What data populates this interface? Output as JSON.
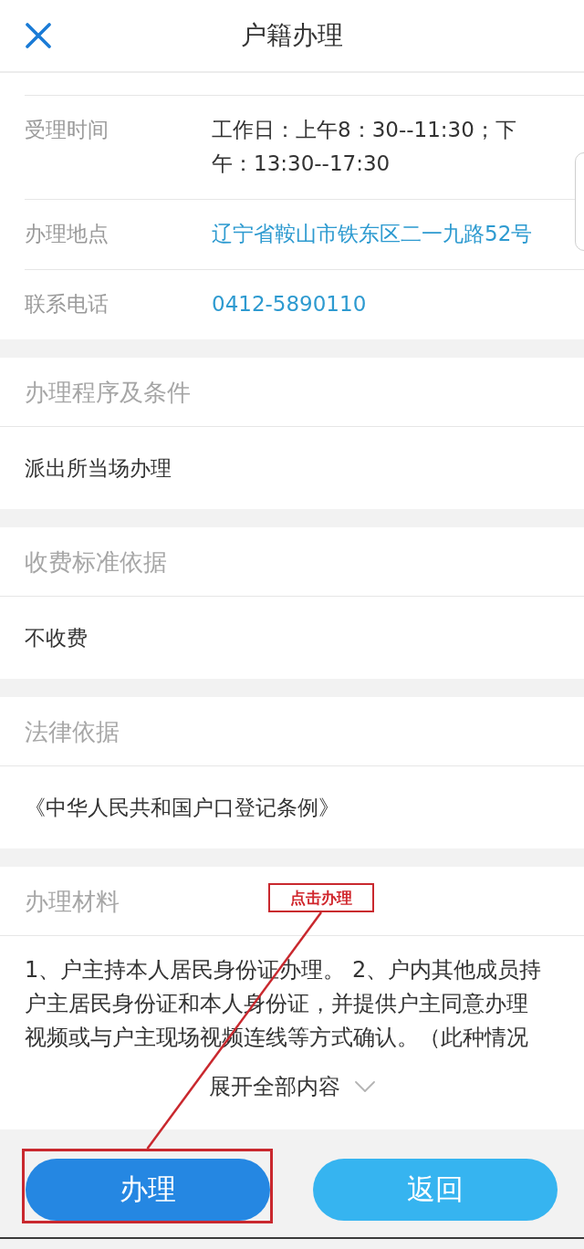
{
  "header": {
    "title": "户籍办理"
  },
  "info_rows": [
    {
      "label": "受理时间",
      "value": "工作日：上午8：30--11:30；下午：13:30--17:30",
      "kind": "text"
    },
    {
      "label": "办理地点",
      "value": "辽宁省鞍山市铁东区二一九路52号",
      "kind": "address"
    },
    {
      "label": "联系电话",
      "value": "0412-5890110",
      "kind": "phone"
    }
  ],
  "sections": [
    {
      "title": "办理程序及条件",
      "content": "派出所当场办理"
    },
    {
      "title": "收费标准依据",
      "content": "不收费"
    },
    {
      "title": "法律依据",
      "content": "《中华人民共和国户口登记条例》"
    },
    {
      "title": "办理材料",
      "content": "1、户主持本人居民身份证办理。 2、户内其他成员持户主居民身份证和本人身份证，并提供户主同意办理视频或与户主现场视频连线等方式确认。（此种情况",
      "expand_label": "展开全部内容"
    }
  ],
  "buttons": [
    {
      "label": "办理",
      "kind": "primary",
      "highlighted": true
    },
    {
      "label": "返回",
      "kind": "secondary",
      "highlighted": false
    }
  ],
  "annotation": {
    "label": "点击办理"
  }
}
